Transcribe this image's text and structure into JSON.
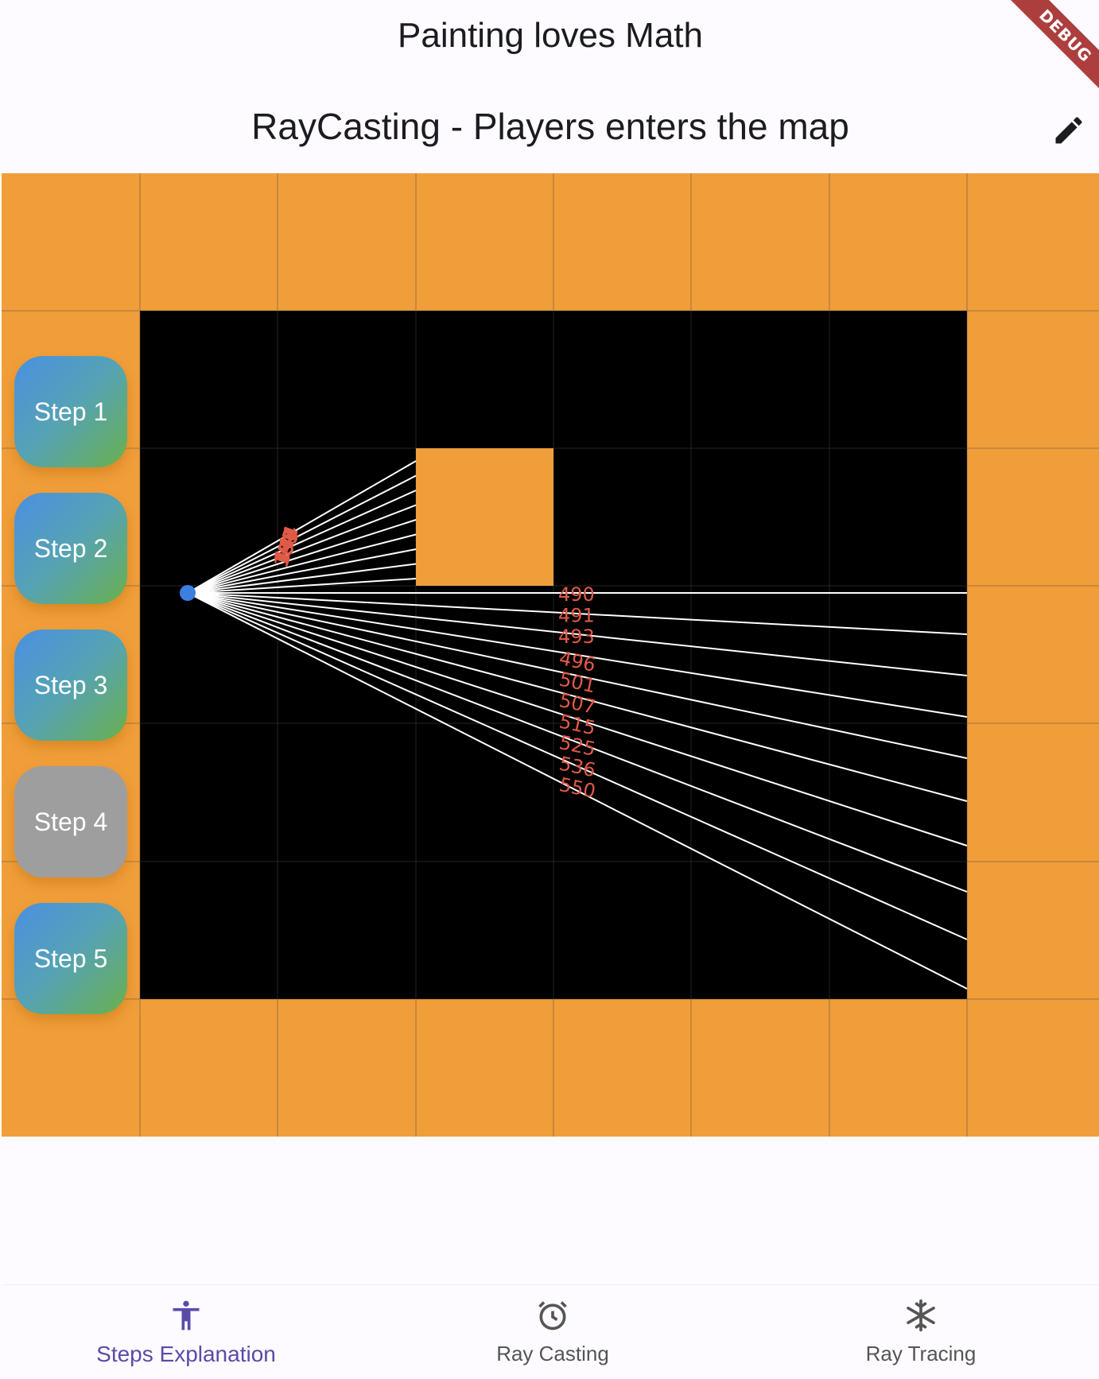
{
  "app": {
    "title": "Painting loves Math",
    "page_title": "RayCasting -  Players enters the map",
    "debug_banner": "DEBUG"
  },
  "colors": {
    "wall": "#f09e3a",
    "floor": "#000000",
    "ray": "#ffffff",
    "ray_label": "#e05a47",
    "player": "#3d7fe0",
    "nav_active": "#5b4ba8"
  },
  "steps": [
    {
      "label": "Step 1",
      "state": "active"
    },
    {
      "label": "Step 2",
      "state": "active"
    },
    {
      "label": "Step 3",
      "state": "active"
    },
    {
      "label": "Step 4",
      "state": "inactive"
    },
    {
      "label": "Step 5",
      "state": "active"
    }
  ],
  "ray_labels_obstacle": [
    "166",
    "161",
    "157",
    "153",
    "150",
    "147",
    "145",
    "144",
    "144"
  ],
  "ray_labels_open": [
    "490",
    "491",
    "493",
    "496",
    "501",
    "507",
    "515",
    "525",
    "536",
    "550"
  ],
  "nav": [
    {
      "label": "Steps Explanation",
      "icon": "accessibility-icon",
      "active": true
    },
    {
      "label": "Ray Casting",
      "icon": "alarm-clock-icon",
      "active": false
    },
    {
      "label": "Ray Tracing",
      "icon": "snowflake-icon",
      "active": false
    }
  ]
}
